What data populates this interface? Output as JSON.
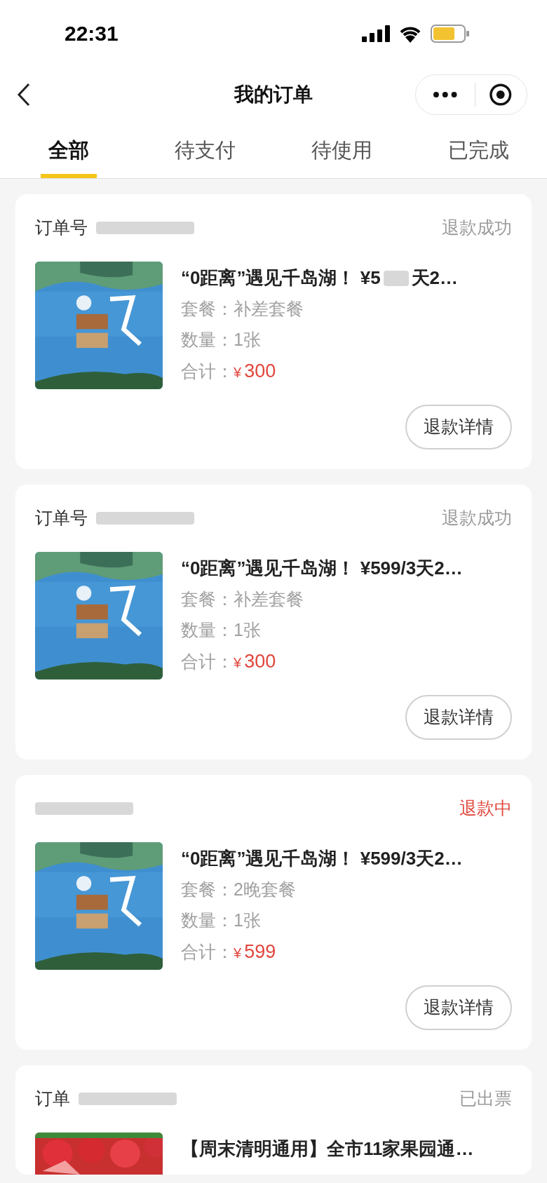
{
  "status_bar": {
    "time": "22:31"
  },
  "nav": {
    "title": "我的订单"
  },
  "tabs": [
    {
      "label": "全部",
      "selected": true
    },
    {
      "label": "待支付",
      "selected": false
    },
    {
      "label": "待使用",
      "selected": false
    },
    {
      "label": "已完成",
      "selected": false
    }
  ],
  "orders": [
    {
      "kind": "lake",
      "order_label": "订单号",
      "redacted": true,
      "status": {
        "text": "退款成功",
        "color": "#9a9a9a"
      },
      "title": "“0距离”遇见千岛湖！ ¥5",
      "title_end": "天2…",
      "package_label": "套餐：",
      "package": "补差套餐",
      "quantity_label": "数量：",
      "quantity": "1张",
      "total_label": "合计：",
      "currency": "¥",
      "total": "300",
      "button": "退款详情"
    },
    {
      "kind": "lake",
      "order_label": "订单号",
      "redacted": true,
      "status": {
        "text": "退款成功",
        "color": "#9a9a9a"
      },
      "title": "“0距离”遇见千岛湖！ ¥599/3天2…",
      "package_label": "套餐：",
      "package": "补差套餐",
      "quantity_label": "数量：",
      "quantity": "1张",
      "total_label": "合计：",
      "currency": "¥",
      "total": "300",
      "button": "退款详情"
    },
    {
      "kind": "lake",
      "redacted": true,
      "status": {
        "text": "退款中",
        "color": "#e0463c"
      },
      "title": "“0距离”遇见千岛湖！ ¥599/3天2…",
      "package_label": "套餐：",
      "package": "2晚套餐",
      "quantity_label": "数量：",
      "quantity": "1张",
      "total_label": "合计：",
      "currency": "¥",
      "total": "599",
      "button": "退款详情"
    },
    {
      "kind": "strawberry",
      "order_label": "订单",
      "redacted": true,
      "status": {
        "text": "已出票",
        "color": "#9a9a9a"
      },
      "title": "【周末清明通用】全市11家果园通…"
    }
  ]
}
